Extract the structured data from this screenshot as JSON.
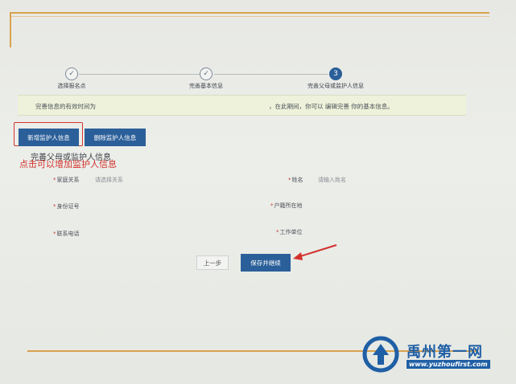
{
  "stepper": {
    "steps": [
      {
        "label": "选择报名点",
        "marker": "✓",
        "state": "done"
      },
      {
        "label": "完善基本信息",
        "marker": "✓",
        "state": "done"
      },
      {
        "label": "完善父母或监护人信息",
        "marker": "3",
        "state": "active"
      }
    ]
  },
  "notice": {
    "left": "完善信息的有效时间为",
    "right": "，在此期间，你可以 编辑完善 你的基本信息。"
  },
  "actions": {
    "add_label": "新增监护人信息",
    "delete_label": "删除监护人信息"
  },
  "form": {
    "title": "完善父母或监护人信息",
    "annotation": "点击可以增加监护人信息",
    "fields": {
      "relation": {
        "label": "家庭关系",
        "required": "*",
        "placeholder": "请选择关系"
      },
      "name": {
        "label": "姓名",
        "required": "*",
        "placeholder": "请输入姓名"
      },
      "id_card": {
        "label": "身份证号",
        "required": "*"
      },
      "residence": {
        "label": "户籍所在地",
        "required": "*"
      },
      "phone": {
        "label": "联系电话",
        "required": "*"
      },
      "work_unit": {
        "label": "工作单位",
        "required": "*"
      }
    }
  },
  "footer": {
    "prev_label": "上一步",
    "save_label": "保存并继续"
  },
  "watermark": {
    "name": "禹州第一网",
    "url": "www.yuzhoufirst.com"
  },
  "colors": {
    "primary": "#2b5f99",
    "accent": "#d9a14c",
    "annotation": "#d3322c",
    "notice_bg": "#eef2da"
  }
}
